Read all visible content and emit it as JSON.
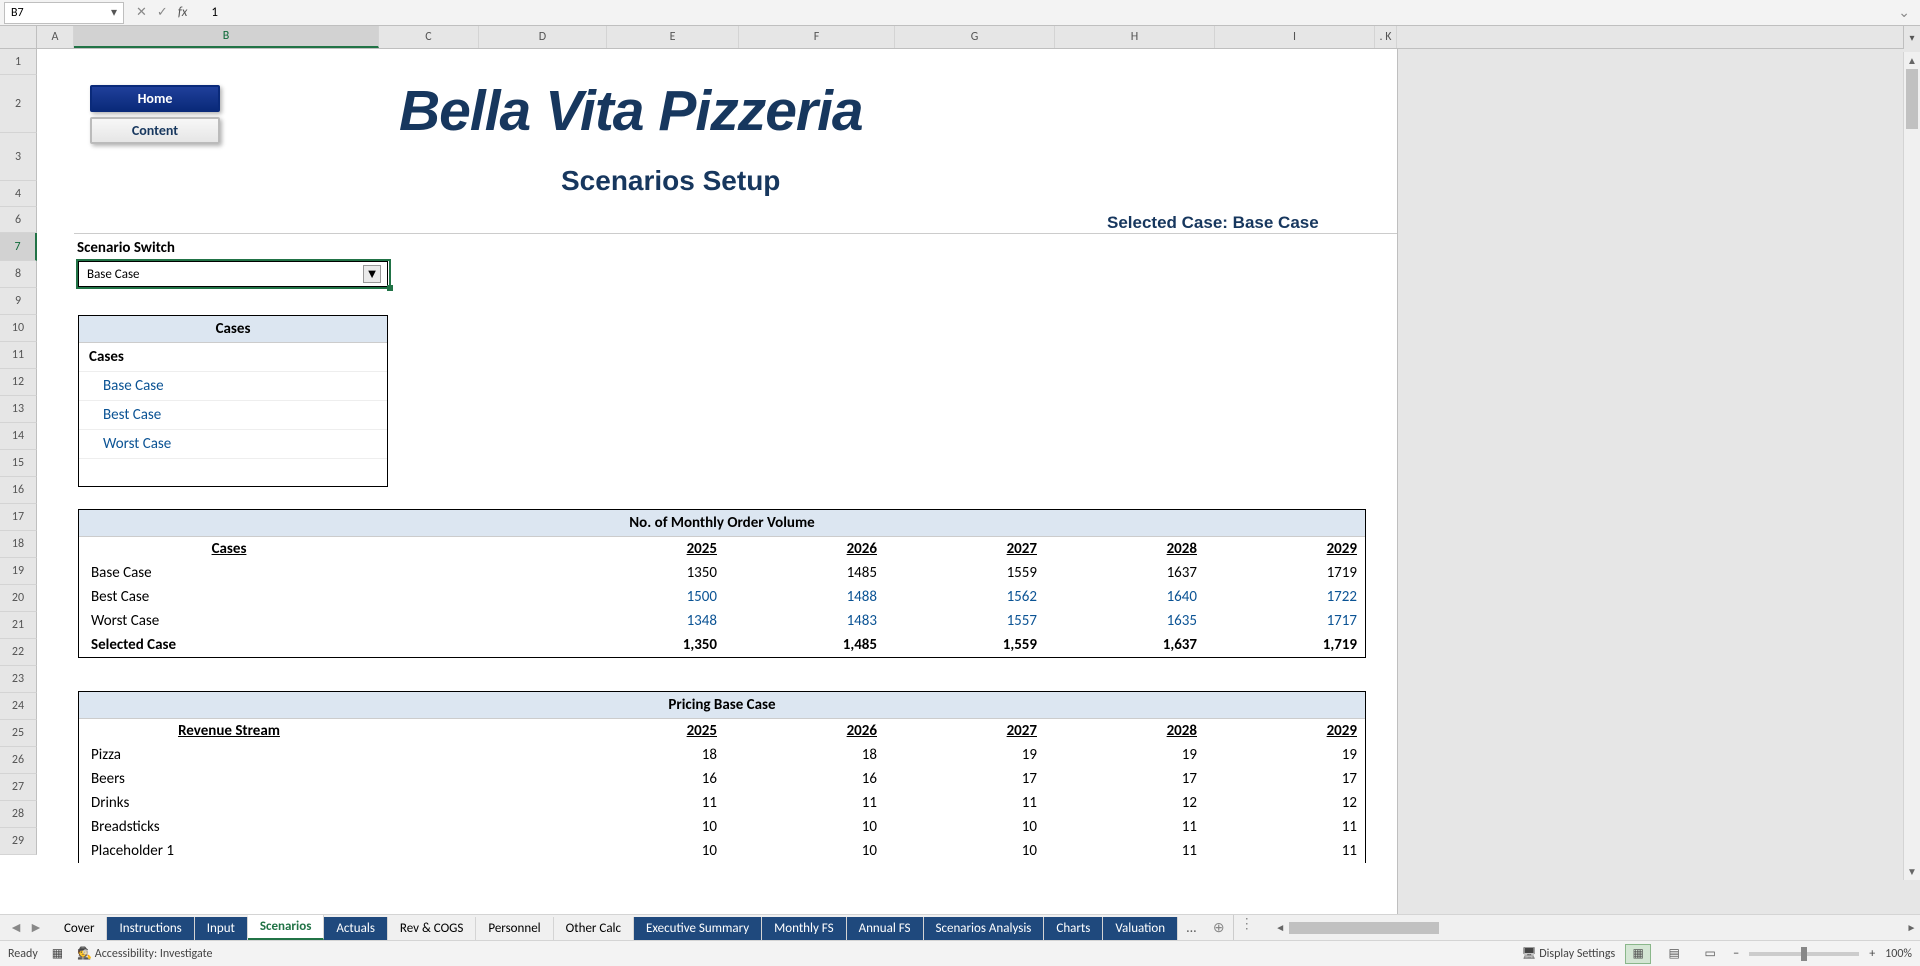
{
  "formula_bar": {
    "cell_ref": "B7",
    "value": "1"
  },
  "columns": [
    "A",
    "B",
    "C",
    "D",
    "E",
    "F",
    "G",
    "H",
    "I",
    ". K"
  ],
  "row_headers": [
    "1",
    "2",
    "3",
    "4",
    "6",
    "7",
    "8",
    "9",
    "10",
    "11",
    "12",
    "13",
    "14",
    "15",
    "16",
    "17",
    "18",
    "19",
    "20",
    "21",
    "22",
    "23",
    "24",
    "25",
    "26",
    "27",
    "28",
    "29"
  ],
  "title": "Bella Vita Pizzeria",
  "subtitle": "Scenarios Setup",
  "buttons": {
    "home": "Home",
    "content": "Content"
  },
  "selected_case_label": "Selected Case: Base Case",
  "scenario_switch": {
    "label": "Scenario Switch",
    "value": "Base Case"
  },
  "cases_box": {
    "header": "Cases",
    "group": "Cases",
    "items": [
      "Base Case",
      "Best Case",
      "Worst Case"
    ]
  },
  "orders_table": {
    "title": "No. of Monthly Order Volume",
    "col1": "Cases",
    "years": [
      "2025",
      "2026",
      "2027",
      "2028",
      "2029"
    ],
    "rows": [
      {
        "label": "Base Case",
        "vals": [
          "1350",
          "1485",
          "1559",
          "1637",
          "1719"
        ],
        "blue": false
      },
      {
        "label": "Best Case",
        "vals": [
          "1500",
          "1488",
          "1562",
          "1640",
          "1722"
        ],
        "blue": true
      },
      {
        "label": "Worst Case",
        "vals": [
          "1348",
          "1483",
          "1557",
          "1635",
          "1717"
        ],
        "blue": true
      }
    ],
    "selected": {
      "label": "Selected Case",
      "vals": [
        "1,350",
        "1,485",
        "1,559",
        "1,637",
        "1,719"
      ]
    }
  },
  "pricing_table": {
    "title": "Pricing Base Case",
    "col1": "Revenue Stream",
    "years": [
      "2025",
      "2026",
      "2027",
      "2028",
      "2029"
    ],
    "rows": [
      {
        "label": "Pizza",
        "vals": [
          "18",
          "18",
          "19",
          "19",
          "19"
        ]
      },
      {
        "label": "Beers",
        "vals": [
          "16",
          "16",
          "17",
          "17",
          "17"
        ]
      },
      {
        "label": "Drinks",
        "vals": [
          "11",
          "11",
          "11",
          "12",
          "12"
        ]
      },
      {
        "label": "Breadsticks",
        "vals": [
          "10",
          "10",
          "10",
          "11",
          "11"
        ]
      },
      {
        "label": "Placeholder 1",
        "vals": [
          "10",
          "10",
          "10",
          "11",
          "11"
        ]
      }
    ]
  },
  "tabs": [
    {
      "label": "Cover",
      "cls": ""
    },
    {
      "label": "Instructions",
      "cls": "blue"
    },
    {
      "label": "Input",
      "cls": "blue"
    },
    {
      "label": "Scenarios",
      "cls": "active"
    },
    {
      "label": "Actuals",
      "cls": "blue"
    },
    {
      "label": "Rev & COGS",
      "cls": ""
    },
    {
      "label": "Personnel",
      "cls": ""
    },
    {
      "label": "Other Calc",
      "cls": ""
    },
    {
      "label": "Executive Summary",
      "cls": "blue"
    },
    {
      "label": "Monthly FS",
      "cls": "blue"
    },
    {
      "label": "Annual FS",
      "cls": "blue"
    },
    {
      "label": "Scenarios Analysis",
      "cls": "blue"
    },
    {
      "label": "Charts",
      "cls": "blue"
    },
    {
      "label": "Valuation",
      "cls": "blue"
    }
  ],
  "tabs_more": "...",
  "status": {
    "ready": "Ready",
    "accessibility": "Accessibility: Investigate",
    "display": "Display Settings",
    "zoom": "100%"
  }
}
